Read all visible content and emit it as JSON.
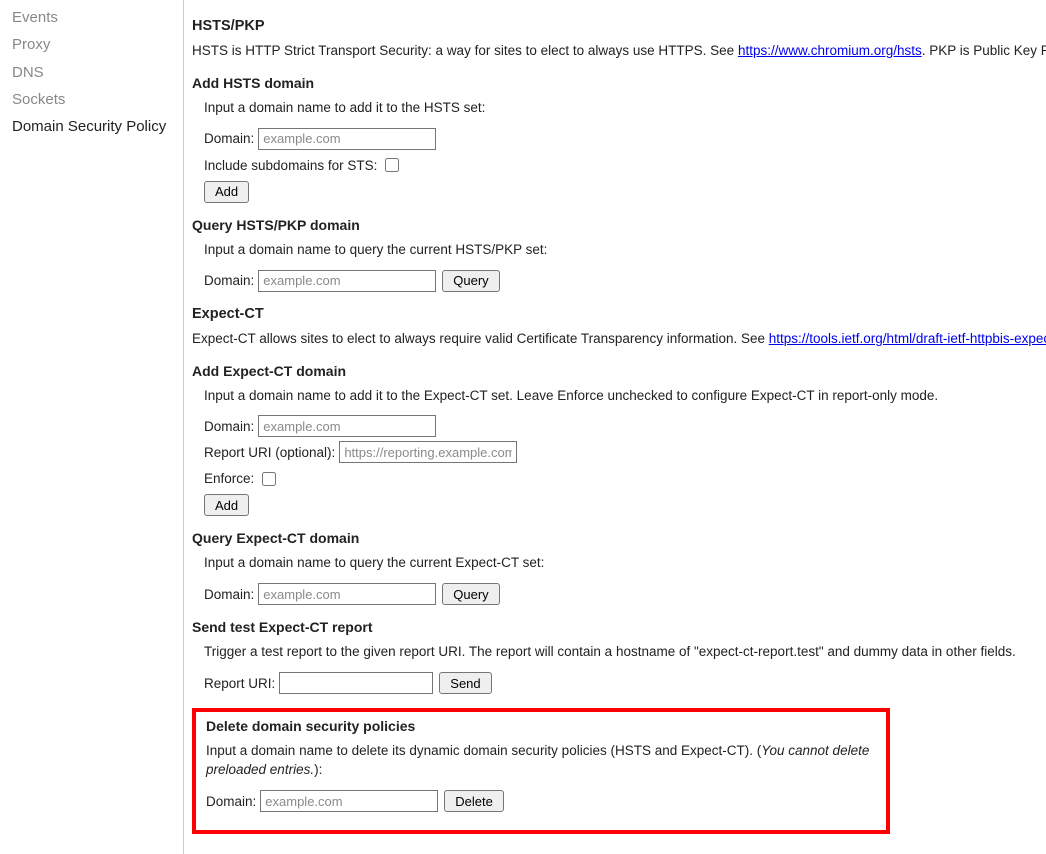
{
  "sidebar": {
    "items": [
      {
        "label": "Events",
        "active": false
      },
      {
        "label": "Proxy",
        "active": false
      },
      {
        "label": "DNS",
        "active": false
      },
      {
        "label": "Sockets",
        "active": false
      },
      {
        "label": "Domain Security Policy",
        "active": true
      }
    ]
  },
  "hsts": {
    "heading": "HSTS/PKP",
    "desc_prefix": "HSTS is HTTP Strict Transport Security: a way for sites to elect to always use HTTPS. See ",
    "desc_link": "https://www.chromium.org/hsts",
    "desc_suffix": ". PKP is Public Key Pinning: Chrome \"pins\" c",
    "add": {
      "title": "Add HSTS domain",
      "instr": "Input a domain name to add it to the HSTS set:",
      "domain_label": "Domain:",
      "domain_placeholder": "example.com",
      "include_subdomains_label": "Include subdomains for STS:",
      "add_button": "Add"
    },
    "query": {
      "title": "Query HSTS/PKP domain",
      "instr": "Input a domain name to query the current HSTS/PKP set:",
      "domain_label": "Domain:",
      "domain_placeholder": "example.com",
      "query_button": "Query"
    }
  },
  "expectct": {
    "heading": "Expect-CT",
    "desc_prefix": "Expect-CT allows sites to elect to always require valid Certificate Transparency information. See ",
    "desc_link": "https://tools.ietf.org/html/draft-ietf-httpbis-expect-ct",
    "desc_suffix": ".",
    "add": {
      "title": "Add Expect-CT domain",
      "instr": "Input a domain name to add it to the Expect-CT set. Leave Enforce unchecked to configure Expect-CT in report-only mode.",
      "domain_label": "Domain:",
      "domain_placeholder": "example.com",
      "report_uri_label": "Report URI (optional):",
      "report_uri_placeholder": "https://reporting.example.com",
      "enforce_label": "Enforce:",
      "add_button": "Add"
    },
    "query": {
      "title": "Query Expect-CT domain",
      "instr": "Input a domain name to query the current Expect-CT set:",
      "domain_label": "Domain:",
      "domain_placeholder": "example.com",
      "query_button": "Query"
    },
    "test": {
      "title": "Send test Expect-CT report",
      "instr": "Trigger a test report to the given report URI. The report will contain a hostname of \"expect-ct-report.test\" and dummy data in other fields.",
      "report_uri_label": "Report URI:",
      "send_button": "Send"
    }
  },
  "delete": {
    "title": "Delete domain security policies",
    "instr_prefix": "Input a domain name to delete its dynamic domain security policies (HSTS and Expect-CT). (",
    "instr_italic": "You cannot delete preloaded entries.",
    "instr_suffix": "):",
    "domain_label": "Domain:",
    "domain_placeholder": "example.com",
    "delete_button": "Delete"
  }
}
